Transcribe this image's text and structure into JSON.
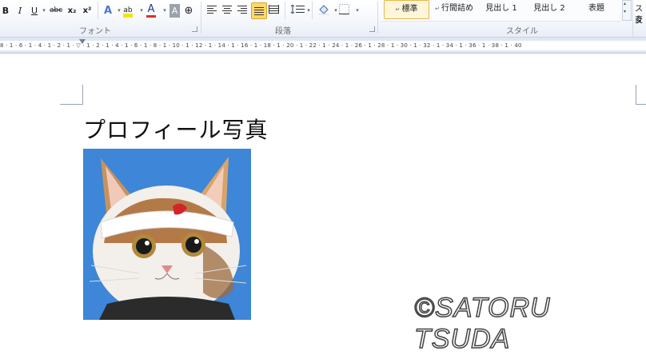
{
  "ribbon": {
    "font_buttons": [
      "B",
      "I",
      "U",
      "abc",
      "x₂",
      "x²",
      "A",
      "ab",
      "A",
      "A",
      "⊕"
    ],
    "font_group_label": "フォント",
    "paragraph_group_label": "段落",
    "style_group_label": "スタイル",
    "styles": [
      {
        "label": "標準",
        "selected": true
      },
      {
        "label": "行間詰め",
        "selected": false
      },
      {
        "label": "見出し 1",
        "selected": false
      },
      {
        "label": "見出し 2",
        "selected": false
      },
      {
        "label": "表題",
        "selected": false
      }
    ],
    "change_style_label": "スタ",
    "change_style_label2": "変"
  },
  "ruler": {
    "text": "8 · 1 · 6 · 1 · 4 · 1 · 2 · 1 · ▽ · 1 · 2 · 1 · 4 · 1 · 6 · 1 · 8 · 1 · 10 · 1 · 12 · 1 · 14 · 1 · 16 · 1 · 18 · 1 · 20 · 1 · 22 · 1 · 24 · 1 · 26 · 1 · 28 · 1 · 30 · 1 · 32 · 1 · 34 · 1 · 36 · 1 · 38 · 1 · 40"
  },
  "document": {
    "heading": "プロフィール写真",
    "paragraph_mark": "↵",
    "photo_alt": "cat-photo"
  },
  "watermark": "©SATORU TSUDA",
  "colors": {
    "ribbon_bg": "#f5f8fc",
    "selected_style": "#fff6d9",
    "photo_bg": "#3d86d8"
  }
}
